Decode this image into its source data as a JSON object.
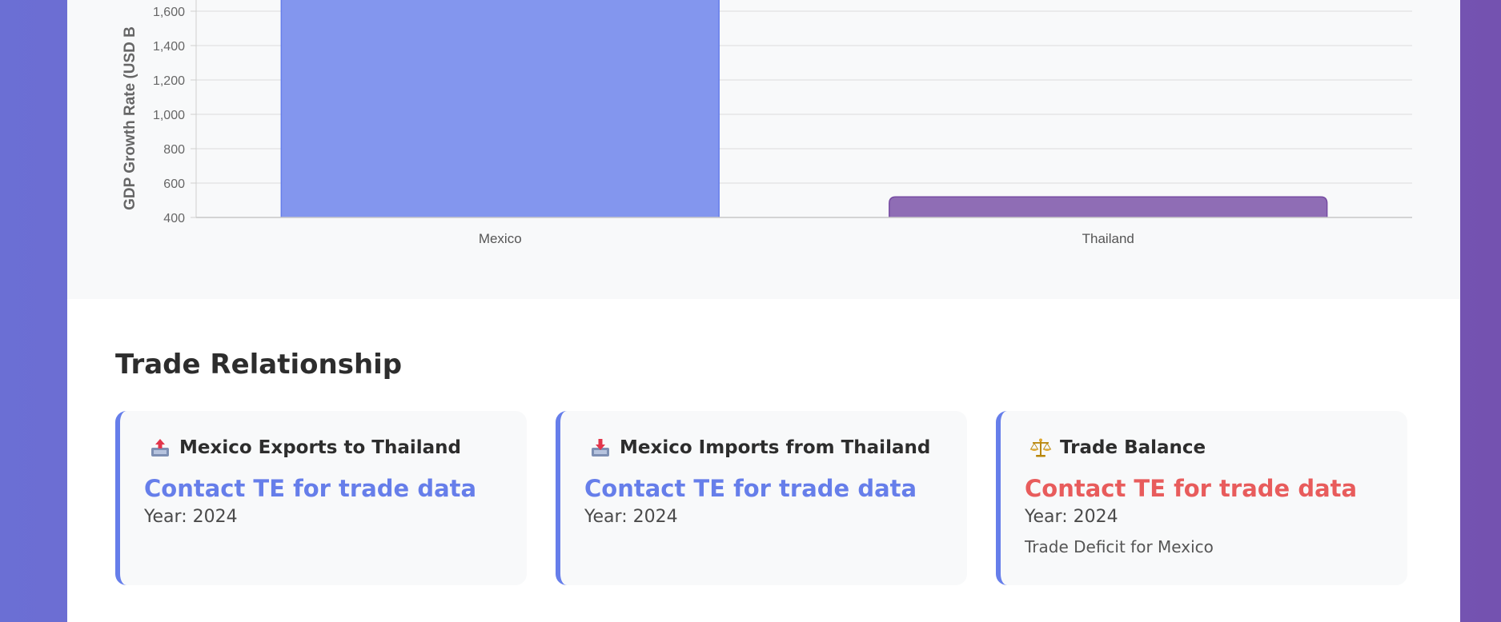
{
  "chart_data": {
    "type": "bar",
    "categories": [
      "Mexico",
      "Thailand"
    ],
    "values": [
      1850,
      520
    ],
    "ylabel": "GDP Growth Rate (USD B",
    "yticks": [
      400,
      600,
      800,
      1000,
      1200,
      1400,
      1600
    ],
    "ytick_labels": [
      "400",
      "600",
      "800",
      "1,000",
      "1,200",
      "1,400",
      "1,600"
    ],
    "ylim": [
      400,
      1720
    ],
    "colors": [
      "#8396ee",
      "#8f6db5"
    ],
    "border_colors": [
      "#667eea",
      "#764ba2"
    ],
    "grid": true
  },
  "trade": {
    "title": "Trade Relationship",
    "cards": [
      {
        "icon": "outbox-tray-icon",
        "title": "Mexico Exports to Thailand",
        "value": "Contact TE for trade data",
        "year": "Year: 2024",
        "note": ""
      },
      {
        "icon": "inbox-tray-icon",
        "title": "Mexico Imports from Thailand",
        "value": "Contact TE for trade data",
        "year": "Year: 2024",
        "note": ""
      },
      {
        "icon": "balance-scale-icon",
        "title": "Trade Balance",
        "value": "Contact TE for trade data",
        "year": "Year: 2024",
        "note": "Trade Deficit for Mexico"
      }
    ]
  }
}
